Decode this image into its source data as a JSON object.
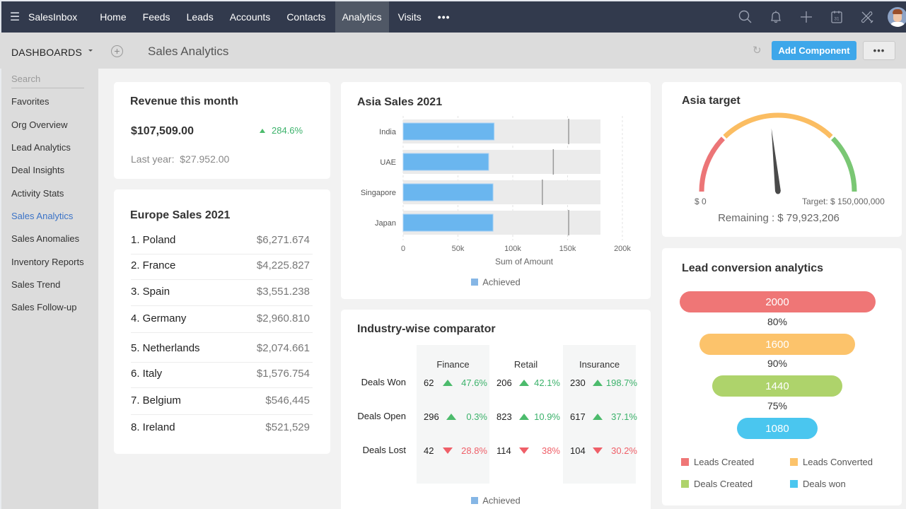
{
  "topnav": {
    "brand": "SalesInbox",
    "items": [
      {
        "label": "Home",
        "active": false
      },
      {
        "label": "Feeds",
        "active": false
      },
      {
        "label": "Leads",
        "active": false
      },
      {
        "label": "Accounts",
        "active": false
      },
      {
        "label": "Contacts",
        "active": false
      },
      {
        "label": "Analytics",
        "active": true
      },
      {
        "label": "Visits",
        "active": false
      }
    ],
    "more": "•••",
    "icons": [
      "search-icon",
      "bell-icon",
      "plus-icon",
      "calendar-icon",
      "tools-icon",
      "avatar"
    ],
    "calendar_day": "31"
  },
  "subheader": {
    "dashboards_label": "DASHBOARDS",
    "page_title": "Sales Analytics",
    "add_component": "Add Component",
    "more": "•••"
  },
  "sidebar": {
    "search_placeholder": "Search",
    "items": [
      {
        "label": "Favorites",
        "active": false
      },
      {
        "label": "Org Overview",
        "active": false
      },
      {
        "label": "Lead Analytics",
        "active": false
      },
      {
        "label": "Deal Insights",
        "active": false
      },
      {
        "label": "Activity Stats",
        "active": false
      },
      {
        "label": "Sales Analytics",
        "active": true
      },
      {
        "label": "Sales Anomalies",
        "active": false
      },
      {
        "label": "Inventory Reports",
        "active": false
      },
      {
        "label": "Sales Trend",
        "active": false
      },
      {
        "label": "Sales Follow-up",
        "active": false
      }
    ]
  },
  "revenue": {
    "title": "Revenue this month",
    "amount": "$107,509.00",
    "change": "284.6%",
    "change_direction": "up",
    "last_year_label": "Last year:",
    "last_year_value": "$27.952.00"
  },
  "europe": {
    "title": "Europe Sales 2021",
    "rows": [
      {
        "name": "1. Poland",
        "value": "$6,271.674"
      },
      {
        "name": "2. France",
        "value": "$4,225.827"
      },
      {
        "name": "3. Spain",
        "value": "$3,551.238"
      },
      {
        "name": "4. Germany",
        "value": "$2,960.810"
      },
      {
        "name": "5. Netherlands",
        "value": "$2,074.661"
      },
      {
        "name": "6. Italy",
        "value": "$1,576.754"
      },
      {
        "name": "7. Belgium",
        "value": "$546,445"
      },
      {
        "name": "8. Ireland",
        "value": "$521,529"
      }
    ]
  },
  "chart_data": [
    {
      "type": "bar",
      "orientation": "horizontal",
      "subtype": "bullet",
      "title": "Asia Sales 2021",
      "categories": [
        "India",
        "UAE",
        "Singapore",
        "Japan"
      ],
      "series": [
        {
          "name": "Achieved",
          "values": [
            83000,
            78000,
            82000,
            82000
          ],
          "color": "#6ab6ef"
        },
        {
          "name": "Target",
          "values": [
            151000,
            137000,
            127000,
            151000
          ],
          "color": "#999999"
        },
        {
          "name": "Range",
          "values": [
            180000,
            180000,
            180000,
            180000
          ],
          "color": "#ebebeb"
        }
      ],
      "xlabel": "Sum of Amount",
      "ylabel": "",
      "xlim": [
        0,
        200000
      ],
      "xticks": [
        "0",
        "50k",
        "100k",
        "150k",
        "200k"
      ],
      "xtick_values": [
        0,
        50000,
        100000,
        150000,
        200000
      ],
      "grid": true,
      "legend": [
        {
          "label": "Achieved",
          "color": "#85b6e5"
        }
      ],
      "legend_position": "bottom"
    },
    {
      "type": "gauge",
      "title": "Asia target",
      "min": 0,
      "max": 150000000,
      "value": 70076794,
      "min_label": "$ 0",
      "max_label": "Target: $ 150,000,000",
      "remaining_label": "Remaining : $ 79,923,206",
      "bands": [
        {
          "from": 0,
          "to": 0.25,
          "color": "#ec7577"
        },
        {
          "from": 0.25,
          "to": 0.75,
          "color": "#fbbd62"
        },
        {
          "from": 0.75,
          "to": 1.0,
          "color": "#7ac774"
        }
      ]
    },
    {
      "type": "funnel",
      "title": "Lead conversion analytics",
      "stages": [
        {
          "label": "Leads Created",
          "value": 2000,
          "color": "#ef7676"
        },
        {
          "label": "Leads Converted",
          "value": 1600,
          "color": "#fcc36b"
        },
        {
          "label": "Deals Created",
          "value": 1440,
          "color": "#aed36b"
        },
        {
          "label": "Deals won",
          "value": 1080,
          "color": "#4ac6ef"
        }
      ],
      "conversion_rates": [
        "80%",
        "90%",
        "75%"
      ],
      "legend_position": "bottom"
    },
    {
      "type": "table",
      "title": "Industry-wise comparator",
      "columns": [
        "Finance",
        "Retail",
        "Insurance"
      ],
      "rows": [
        {
          "label": "Deals Won",
          "cells": [
            {
              "value": "62",
              "change": "47.6%",
              "dir": "up"
            },
            {
              "value": "206",
              "change": "42.1%",
              "dir": "up"
            },
            {
              "value": "230",
              "change": "198.7%",
              "dir": "up"
            }
          ]
        },
        {
          "label": "Deals Open",
          "cells": [
            {
              "value": "296",
              "change": "0.3%",
              "dir": "up"
            },
            {
              "value": "823",
              "change": "10.9%",
              "dir": "up"
            },
            {
              "value": "617",
              "change": "37.1%",
              "dir": "up"
            }
          ]
        },
        {
          "label": "Deals Lost",
          "cells": [
            {
              "value": "42",
              "change": "28.8%",
              "dir": "down"
            },
            {
              "value": "114",
              "change": "38%",
              "dir": "down"
            },
            {
              "value": "104",
              "change": "30.2%",
              "dir": "down"
            }
          ]
        }
      ],
      "legend": [
        {
          "label": "Achieved",
          "color": "#85b6e5"
        }
      ]
    }
  ],
  "colors": {
    "nav_bg": "#323a4d",
    "nav_active": "#505866",
    "accent": "#3ea7ea",
    "up": "#3cb26b",
    "down": "#ef5f68",
    "sidebar_active": "#3b73c7"
  }
}
